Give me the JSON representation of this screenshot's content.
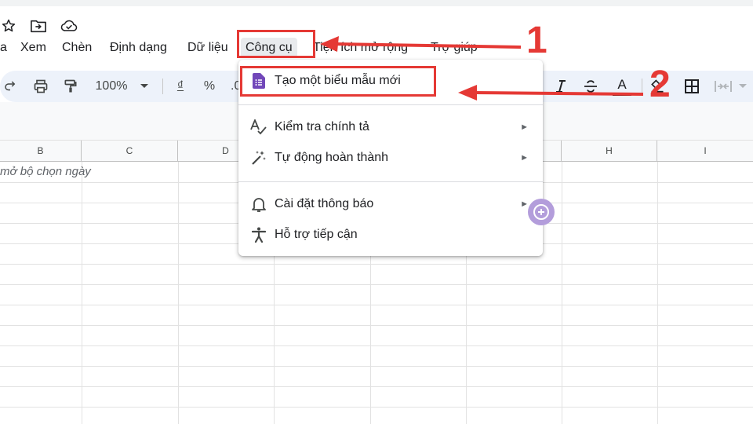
{
  "header": {
    "icons": [
      "star-icon",
      "move-to-folder-icon",
      "cloud-saved-icon"
    ]
  },
  "menubar": {
    "items": [
      {
        "label": "a"
      },
      {
        "label": "Xem"
      },
      {
        "label": "Chèn"
      },
      {
        "label": "Định dạng"
      },
      {
        "label": "Dữ liệu"
      },
      {
        "label": "Công cụ"
      },
      {
        "label": "Tiện ích mở rộng"
      },
      {
        "label": "Trợ giúp"
      }
    ]
  },
  "toolbar": {
    "zoom": "100%",
    "currency_label": "₫",
    "percent_label": "%",
    "decimal_label": ".0",
    "text_color_label": "A"
  },
  "grid": {
    "columns": [
      "B",
      "C",
      "D",
      "H",
      "I"
    ],
    "cell_b1": "mở bộ chọn ngày"
  },
  "tools_menu": {
    "items": [
      {
        "label": "Tạo một biểu mẫu mới",
        "icon": "google-forms-icon",
        "has_submenu": false
      },
      {
        "label": "Kiểm tra chính tả",
        "icon": "spellcheck-icon",
        "has_submenu": true
      },
      {
        "label": "Tự động hoàn thành",
        "icon": "magic-wand-icon",
        "has_submenu": true
      },
      {
        "label": "Cài đặt thông báo",
        "icon": "bell-icon",
        "has_submenu": true
      },
      {
        "label": "Hỗ trợ tiếp cận",
        "icon": "accessibility-icon",
        "has_submenu": false
      }
    ],
    "submenu_arrow": "►"
  },
  "annotations": {
    "step1": "1",
    "step2": "2",
    "color": "#e53935"
  },
  "colors": {
    "toolbar_bg": "#edf2fa",
    "forms_purple": "#7248b9",
    "active_menu_bg": "#e8eaed"
  }
}
